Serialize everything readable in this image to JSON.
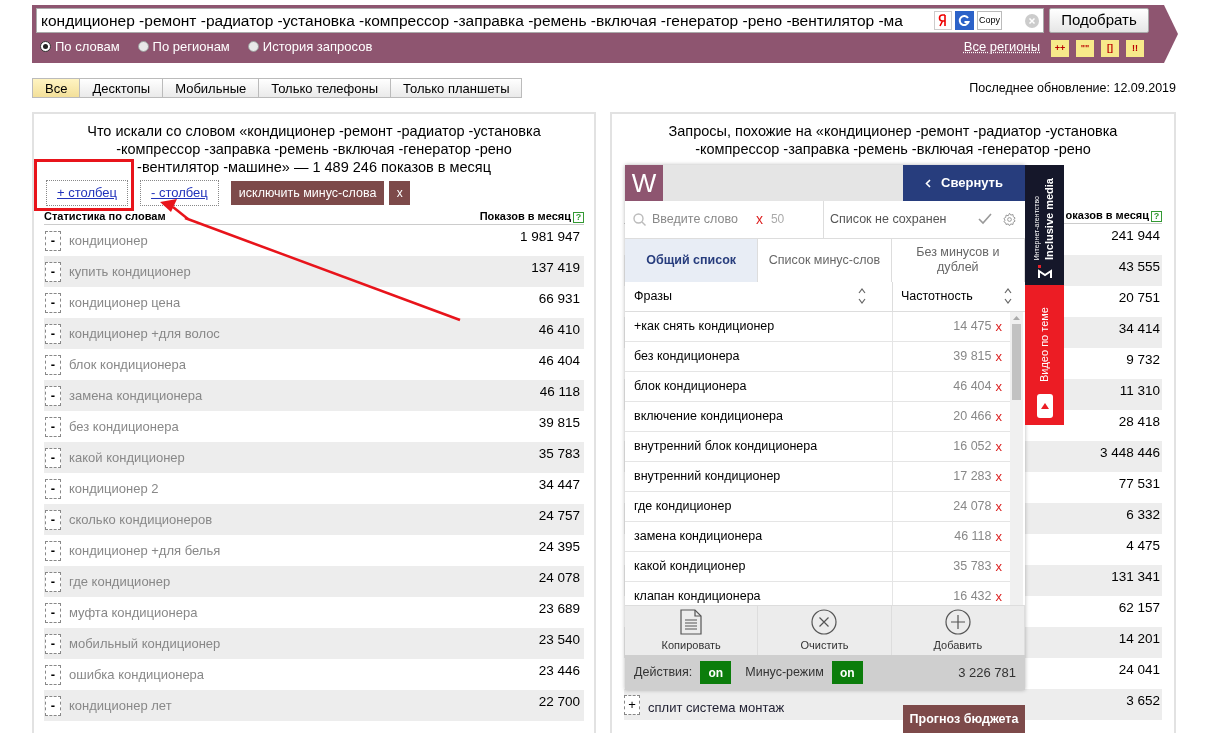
{
  "search": {
    "value": "кондиционер -ремонт -радиатор -установка -компрессор -заправка -ремень -включая -генератор -рено -вентилятор -ма",
    "copy": "Copy",
    "submit": "Подобрать"
  },
  "modes": [
    {
      "label": "По словам",
      "selected": true
    },
    {
      "label": "По регионам",
      "selected": false
    },
    {
      "label": "История запросов",
      "selected": false
    }
  ],
  "regions_link": "Все регионы",
  "operators": [
    "++",
    "\"\"",
    "[]",
    "!!"
  ],
  "device_tabs": [
    {
      "label": "Все",
      "selected": true
    },
    {
      "label": "Десктопы",
      "selected": false
    },
    {
      "label": "Мобильные",
      "selected": false
    },
    {
      "label": "Только телефоны",
      "selected": false
    },
    {
      "label": "Только планшеты",
      "selected": false
    }
  ],
  "last_update": "Последнее обновление: 12.09.2019",
  "left_panel": {
    "title": "Что искали со словом «кондиционер -ремонт -радиатор -установка -компрессор -заправка -ремень -включая -генератор -рено -вентилятор -машине» — 1 489 246 показов в месяц",
    "add_column": "+ столбец",
    "remove_column": "- столбец",
    "exclude_button": "исключить минус-слова",
    "exclude_close": "x",
    "col_phrase": "Статистика по словам",
    "col_count": "Показов в месяц",
    "help": "?",
    "rows": [
      {
        "action": "-",
        "phrase": "кондиционер",
        "count": "1 981 947"
      },
      {
        "action": "-",
        "phrase": "купить кондиционер",
        "count": "137 419"
      },
      {
        "action": "-",
        "phrase": "кондиционер цена",
        "count": "66 931"
      },
      {
        "action": "-",
        "phrase": "кондиционер +для волос",
        "count": "46 410"
      },
      {
        "action": "-",
        "phrase": "блок кондиционера",
        "count": "46 404"
      },
      {
        "action": "-",
        "phrase": "замена кондиционера",
        "count": "46 118"
      },
      {
        "action": "-",
        "phrase": "без кондиционера",
        "count": "39 815"
      },
      {
        "action": "-",
        "phrase": "какой кондиционер",
        "count": "35 783"
      },
      {
        "action": "-",
        "phrase": "кондиционер 2",
        "count": "34 447"
      },
      {
        "action": "-",
        "phrase": "сколько кондиционеров",
        "count": "24 757"
      },
      {
        "action": "-",
        "phrase": "кондиционер +для белья",
        "count": "24 395"
      },
      {
        "action": "-",
        "phrase": "где кондиционер",
        "count": "24 078"
      },
      {
        "action": "-",
        "phrase": "муфта кондиционера",
        "count": "23 689"
      },
      {
        "action": "-",
        "phrase": "мобильный кондиционер",
        "count": "23 540"
      },
      {
        "action": "-",
        "phrase": "ошибка кондиционера",
        "count": "23 446"
      },
      {
        "action": "-",
        "phrase": "кондиционер лет",
        "count": "22 700"
      }
    ]
  },
  "right_panel": {
    "title": "Запросы, похожие на «кондиционер -ремонт -радиатор -установка -компрессор -заправка -ремень -включая -генератор -рено",
    "col_count": "оказов в месяц",
    "help": "?",
    "rows": [
      {
        "count": "241 944"
      },
      {
        "count": "43 555"
      },
      {
        "count": "20 751"
      },
      {
        "count": "34 414"
      },
      {
        "count": "9 732"
      },
      {
        "count": "11 310"
      },
      {
        "count": "28 418"
      },
      {
        "count": "3 448 446"
      },
      {
        "count": "77 531"
      },
      {
        "count": "6 332"
      },
      {
        "count": "4 475"
      },
      {
        "count": "131 341"
      },
      {
        "count": "62 157"
      },
      {
        "count": "14 201"
      },
      {
        "count": "24 041"
      },
      {
        "action": "+",
        "phrase": "сплит система монтаж",
        "count": "3 652"
      }
    ],
    "forecast_button": "Прогноз бюджета"
  },
  "widget": {
    "logo": "W",
    "collapse": "Свернуть",
    "search_placeholder": "Введите слово",
    "clear": "x",
    "limit": "50",
    "list_status": "Список не сохранен",
    "tabs": [
      {
        "label": "Общий список",
        "selected": true
      },
      {
        "label": "Список минус-слов",
        "selected": false
      },
      {
        "label": "Без минусов и дублей",
        "selected": false
      }
    ],
    "col_phrase": "Фразы",
    "col_freq": "Частотность",
    "rows": [
      {
        "phrase": "+как снять кондиционер",
        "count": "14 475",
        "remove": "x"
      },
      {
        "phrase": "без кондиционера",
        "count": "39 815",
        "remove": "x"
      },
      {
        "phrase": "блок кондиционера",
        "count": "46 404",
        "remove": "x"
      },
      {
        "phrase": "включение кондиционера",
        "count": "20 466",
        "remove": "x"
      },
      {
        "phrase": "внутренний блок кондиционера",
        "count": "16 052",
        "remove": "x"
      },
      {
        "phrase": "внутренний кондиционер",
        "count": "17 283",
        "remove": "x"
      },
      {
        "phrase": "где кондиционер",
        "count": "24 078",
        "remove": "x"
      },
      {
        "phrase": "замена кондиционера",
        "count": "46 118",
        "remove": "x"
      },
      {
        "phrase": "какой кондиционер",
        "count": "35 783",
        "remove": "x"
      },
      {
        "phrase": "клапан кондиционера",
        "count": "16 432",
        "remove": "x"
      }
    ],
    "actions": [
      {
        "kind": "copy",
        "label": "Копировать"
      },
      {
        "kind": "clear",
        "label": "Очистить"
      },
      {
        "kind": "add",
        "label": "Добавить"
      }
    ],
    "toggles": [
      {
        "label": "Действия:",
        "text": "on",
        "on": true
      },
      {
        "label": "Минус-режим",
        "text": "on",
        "on": true
      }
    ],
    "total": "3 226 781"
  },
  "ad": {
    "agency": "Интернет-агентство",
    "brand": "Inclusive media",
    "video": "Видео по теме"
  }
}
